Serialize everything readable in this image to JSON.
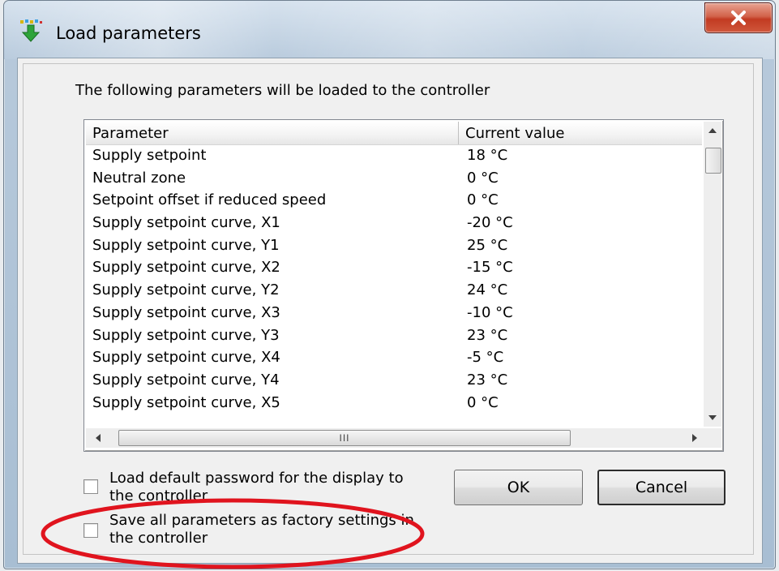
{
  "window": {
    "title": "Load parameters",
    "close_label": "x"
  },
  "dialog": {
    "intro": "The following parameters will be loaded to the controller"
  },
  "list": {
    "columns": [
      "Parameter",
      "Current value"
    ],
    "rows": [
      {
        "parameter": "Supply setpoint",
        "value": "18 °C"
      },
      {
        "parameter": "Neutral zone",
        "value": "0 °C"
      },
      {
        "parameter": "Setpoint offset if reduced speed",
        "value": "0 °C"
      },
      {
        "parameter": "Supply setpoint curve, X1",
        "value": "-20 °C"
      },
      {
        "parameter": "Supply setpoint curve, Y1",
        "value": "25 °C"
      },
      {
        "parameter": "Supply setpoint curve, X2",
        "value": "-15 °C"
      },
      {
        "parameter": "Supply setpoint curve, Y2",
        "value": "24 °C"
      },
      {
        "parameter": "Supply setpoint curve, X3",
        "value": "-10 °C"
      },
      {
        "parameter": "Supply setpoint curve, Y3",
        "value": "23 °C"
      },
      {
        "parameter": "Supply setpoint curve, X4",
        "value": "-5 °C"
      },
      {
        "parameter": "Supply setpoint curve, Y4",
        "value": "23 °C"
      },
      {
        "parameter": "Supply setpoint curve, X5",
        "value": "0 °C"
      }
    ],
    "hscroll_grip": "III"
  },
  "options": {
    "load_default_password": {
      "label_line1": "Load default password for the display to",
      "label_line2": "the controller",
      "checked": false
    },
    "save_factory_settings": {
      "label_line1": "Save all parameters as factory settings in",
      "label_line2": "the controller",
      "checked": false
    }
  },
  "buttons": {
    "ok": "OK",
    "cancel": "Cancel"
  },
  "colors": {
    "annotation": "#e0141e",
    "close_button": "#c23b22"
  }
}
